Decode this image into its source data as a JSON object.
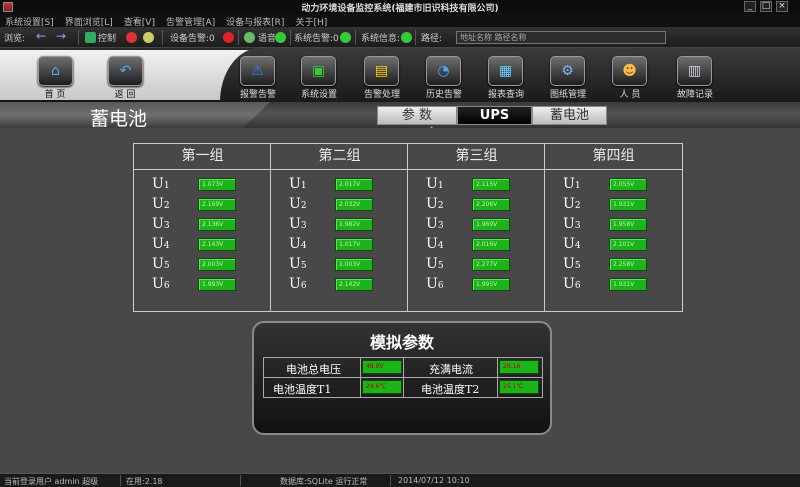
{
  "window": {
    "title": "动力环境设备监控系统(福建市旧识科技有限公司)",
    "min_label": "_",
    "max_label": "□",
    "close_label": "×"
  },
  "menu": [
    "系统设置[S]",
    "界面浏览[L]",
    "查看[V]",
    "告警管理[A]",
    "设备与报表[R]",
    "关于[H]"
  ],
  "toolbar": {
    "browse_label": "浏览:",
    "back_icon": "←",
    "forward_icon": "→",
    "control_label": "控制",
    "device_alarm_label": "设备告警:0",
    "voice_label": "语音",
    "alarm_sound_label": "系统告警:0",
    "system_info_label": "系统信息:",
    "address_label": "路径:",
    "address_value": "地址名称 路径名称"
  },
  "nav": {
    "home_label": "首 页",
    "back_label": "返 回",
    "buttons": [
      {
        "label": "报警告警",
        "icon": "warning-icon",
        "glyph": "⚠",
        "color": "#2a80ff"
      },
      {
        "label": "系统设置",
        "icon": "monitor-icon",
        "glyph": "▣",
        "color": "#3c3"
      },
      {
        "label": "告警处理",
        "icon": "folder-icon",
        "glyph": "▤",
        "color": "#fc0"
      },
      {
        "label": "历史告警",
        "icon": "pie-chart-icon",
        "glyph": "◔",
        "color": "#4af"
      },
      {
        "label": "报表查询",
        "icon": "chart-icon",
        "glyph": "▦",
        "color": "#6cf"
      },
      {
        "label": "图纸管理",
        "icon": "gear-icon",
        "glyph": "⚙",
        "color": "#8af"
      },
      {
        "label": "人 员",
        "icon": "user-icon",
        "glyph": "☻",
        "color": "#fb4"
      },
      {
        "label": "故障记录",
        "icon": "document-icon",
        "glyph": "▥",
        "color": "#ccd"
      }
    ]
  },
  "section": {
    "title": "蓄电池",
    "tabs": [
      "参 数",
      "UPS",
      "蓄电池"
    ],
    "active_tab": "UPS"
  },
  "battery": {
    "groups": [
      {
        "name": "第一组",
        "values": [
          "1.073V",
          "2.169V",
          "2.136V",
          "2.143V",
          "2.003V",
          "1.993V"
        ]
      },
      {
        "name": "第二组",
        "values": [
          "2.017V",
          "2.032V",
          "1.982V",
          "1.017V",
          "1.003V",
          "2.142V"
        ]
      },
      {
        "name": "第三组",
        "values": [
          "2.115V",
          "2.206V",
          "1.969V",
          "2.016V",
          "2.277V",
          "1.995V"
        ]
      },
      {
        "name": "第四组",
        "values": [
          "2.055V",
          "1.931V",
          "1.958V",
          "2.101V",
          "2.258V",
          "1.931V"
        ]
      }
    ],
    "labels": [
      {
        "main": "U",
        "sub": "1"
      },
      {
        "main": "U",
        "sub": "2"
      },
      {
        "main": "U",
        "sub": "3"
      },
      {
        "main": "U",
        "sub": "4"
      },
      {
        "main": "U",
        "sub": "5"
      },
      {
        "main": "U",
        "sub": "6"
      }
    ]
  },
  "analog": {
    "title": "模拟参数",
    "battery_voltage_label": "电池总电压",
    "battery_voltage_value": "48.0V",
    "charge_current_label": "充满电流",
    "charge_current_value": "20.1A",
    "temp1_label": "电池温度T1",
    "temp1_value": "24.6℃",
    "temp2_label": "电池温度T2",
    "temp2_value": "25.1℃"
  },
  "status": {
    "left": "当前登录用户 admin 超级",
    "count": "在用:2.18",
    "center": "数据库:SQLite 运行正常",
    "time": "2014/07/12 10:10"
  }
}
